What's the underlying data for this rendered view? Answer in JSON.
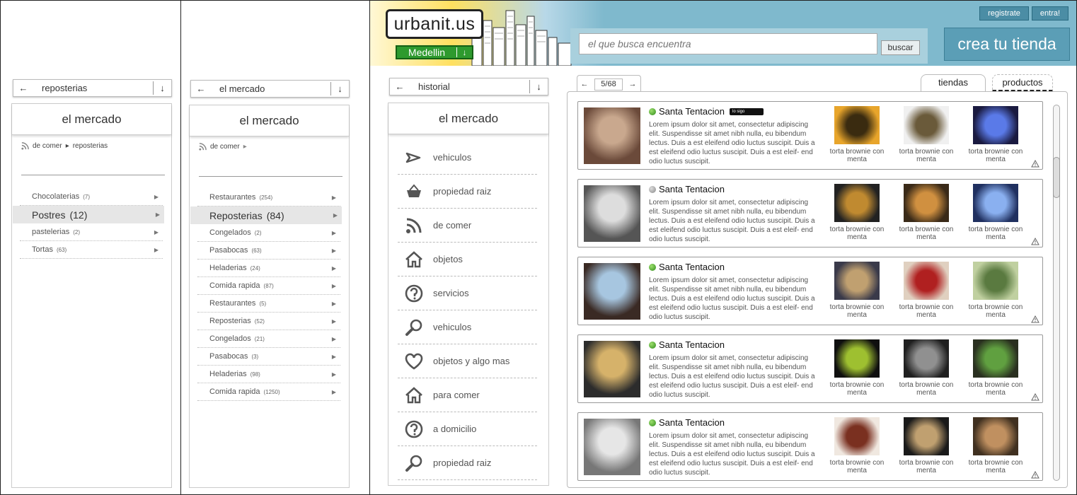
{
  "col1": {
    "nav": {
      "label": "reposterias"
    },
    "panel_title": "el mercado",
    "breadcrumb": [
      "de comer",
      "reposterias"
    ],
    "categories": [
      {
        "name": "Chocolaterias",
        "count": "(7)"
      },
      {
        "name": "Postres",
        "count": "(12)",
        "selected": true
      },
      {
        "name": "pastelerias",
        "count": "(2)"
      },
      {
        "name": "Tortas",
        "count": "(63)"
      }
    ]
  },
  "col2": {
    "nav": {
      "label": "el mercado"
    },
    "panel_title": "el mercado",
    "breadcrumb": [
      "de comer"
    ],
    "categories": [
      {
        "name": "Restaurantes",
        "count": "(254)"
      },
      {
        "name": "Reposterias",
        "count": "(84)",
        "selected": true
      },
      {
        "name": "Congelados",
        "count": "(2)"
      },
      {
        "name": "Pasabocas",
        "count": "(63)"
      },
      {
        "name": "Heladerias",
        "count": "(24)"
      },
      {
        "name": "Comida rapida",
        "count": "(87)"
      },
      {
        "name": "Restaurantes",
        "count": "(5)"
      },
      {
        "name": "Reposterias",
        "count": "(52)"
      },
      {
        "name": "Congelados",
        "count": "(21)"
      },
      {
        "name": "Pasabocas",
        "count": "(3)"
      },
      {
        "name": "Heladerias",
        "count": "(98)"
      },
      {
        "name": "Comida rapida",
        "count": "(1250)"
      }
    ]
  },
  "header": {
    "logo": "urbanit.us",
    "city": "Medellin",
    "search_placeholder": "el que busca encuentra",
    "search_button": "buscar",
    "register": "registrate",
    "login": "entra!",
    "create_store": "crea tu tienda",
    "colors": {
      "header_bg": "#7fb9cd",
      "button": "#5b9eb6",
      "city_green": "#2e9a2e"
    }
  },
  "col3": {
    "nav": {
      "label": "historial"
    },
    "panel_title": "el mercado",
    "menu": [
      {
        "label": "vehiculos",
        "icon": "megaphone-icon"
      },
      {
        "label": "propiedad raiz",
        "icon": "basket-icon"
      },
      {
        "label": "de comer",
        "icon": "rss-icon"
      },
      {
        "label": "objetos",
        "icon": "home-icon"
      },
      {
        "label": "servicios",
        "icon": "question-icon"
      },
      {
        "label": "vehiculos",
        "icon": "search-icon"
      },
      {
        "label": "objetos y algo mas",
        "icon": "heart-icon"
      },
      {
        "label": "para comer",
        "icon": "home-icon"
      },
      {
        "label": "a domicilio",
        "icon": "question-icon"
      },
      {
        "label": "propiedad raiz",
        "icon": "search-icon"
      }
    ]
  },
  "results": {
    "pager": "5/68",
    "tabs": [
      "tiendas",
      "productos"
    ],
    "follow_badge": "lo sigo",
    "stores": [
      {
        "name": "Santa Tentacion",
        "online": true,
        "following": true,
        "desc": "Lorem ipsum dolor sit amet, consectetur adipiscing elit. Suspendisse sit amet nibh nulla, eu bibendum lectus. Duis a est eleifend odio luctus suscipit. Duis a est eleifend odio luctus suscipit. Duis a est eleif- end odio luctus suscipit.",
        "products": [
          "torta brownie con menta",
          "torta brownie con menta",
          "torta brownie con menta"
        ]
      },
      {
        "name": "Santa Tentacion",
        "online": false,
        "following": false,
        "desc": "Lorem ipsum dolor sit amet, consectetur adipiscing elit. Suspendisse sit amet nibh nulla, eu bibendum lectus. Duis a est eleifend odio luctus suscipit. Duis a est eleifend odio luctus suscipit. Duis a est eleif- end odio luctus suscipit.",
        "products": [
          "torta brownie con menta",
          "torta brownie con menta",
          "torta brownie con menta"
        ]
      },
      {
        "name": "Santa Tentacion",
        "online": true,
        "following": false,
        "desc": "Lorem ipsum dolor sit amet, consectetur adipiscing elit. Suspendisse sit amet nibh nulla, eu bibendum lectus. Duis a est eleifend odio luctus suscipit. Duis a est eleifend odio luctus suscipit. Duis a est eleif- end odio luctus suscipit.",
        "products": [
          "torta brownie con menta",
          "torta brownie con menta",
          "torta brownie con menta"
        ]
      },
      {
        "name": "Santa Tentacion",
        "online": true,
        "following": false,
        "desc": "Lorem ipsum dolor sit amet, consectetur adipiscing elit. Suspendisse sit amet nibh nulla, eu bibendum lectus. Duis a est eleifend odio luctus suscipit. Duis a est eleifend odio luctus suscipit. Duis a est eleif- end odio luctus suscipit.",
        "products": [
          "torta brownie con menta",
          "torta brownie con menta",
          "torta brownie con menta"
        ]
      },
      {
        "name": "Santa Tentacion",
        "online": true,
        "following": false,
        "desc": "Lorem ipsum dolor sit amet, consectetur adipiscing elit. Suspendisse sit amet nibh nulla, eu bibendum lectus. Duis a est eleifend odio luctus suscipit. Duis a est eleifend odio luctus suscipit. Duis a est eleif- end odio luctus suscipit.",
        "products": [
          "torta brownie con menta",
          "torta brownie con menta",
          "torta brownie con menta"
        ]
      }
    ]
  }
}
